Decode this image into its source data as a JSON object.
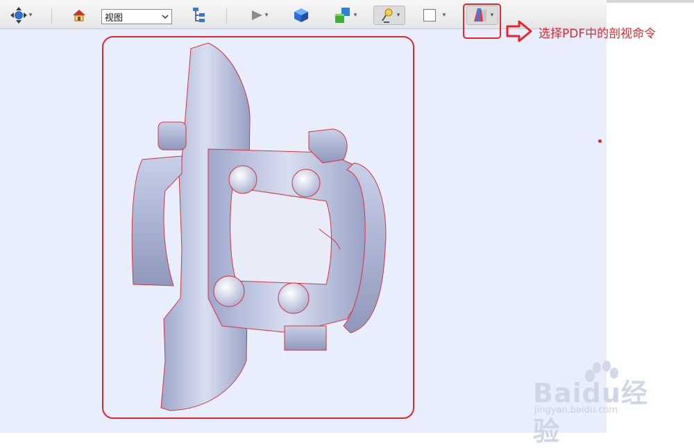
{
  "toolbar": {
    "view_select_value": "视图",
    "caret": "▾",
    "shape_box_label": "□"
  },
  "annotation": {
    "text": "选择PDF中的剖视命令"
  },
  "watermark": {
    "brand": "Baidu经验",
    "url": "jingyan.baidu.com"
  },
  "colors": {
    "annotation_red": "#e5242b",
    "viewport_bg": "#e8eefb",
    "part_fill": "#b8c0dc",
    "section_edge": "#d8323c"
  }
}
